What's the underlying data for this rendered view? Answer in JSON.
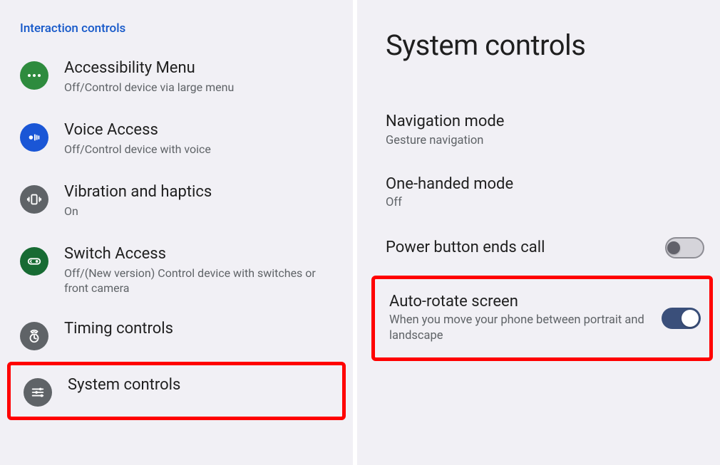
{
  "left": {
    "section_header": "Interaction controls",
    "items": [
      {
        "title": "Accessibility Menu",
        "sub": "Off/Control device via large menu"
      },
      {
        "title": "Voice Access",
        "sub": "Off/Control device with voice"
      },
      {
        "title": "Vibration and haptics",
        "sub": "On"
      },
      {
        "title": "Switch Access",
        "sub": "Off/(New version) Control device with switches or front camera"
      },
      {
        "title": "Timing controls",
        "sub": ""
      },
      {
        "title": "System controls",
        "sub": ""
      }
    ]
  },
  "right": {
    "page_title": "System controls",
    "items": [
      {
        "title": "Navigation mode",
        "sub": "Gesture navigation"
      },
      {
        "title": "One-handed mode",
        "sub": "Off"
      },
      {
        "title": "Power button ends call",
        "sub": "",
        "toggle": "off"
      },
      {
        "title": "Auto-rotate screen",
        "sub": "When you move your phone between portrait and landscape",
        "toggle": "on"
      }
    ]
  }
}
